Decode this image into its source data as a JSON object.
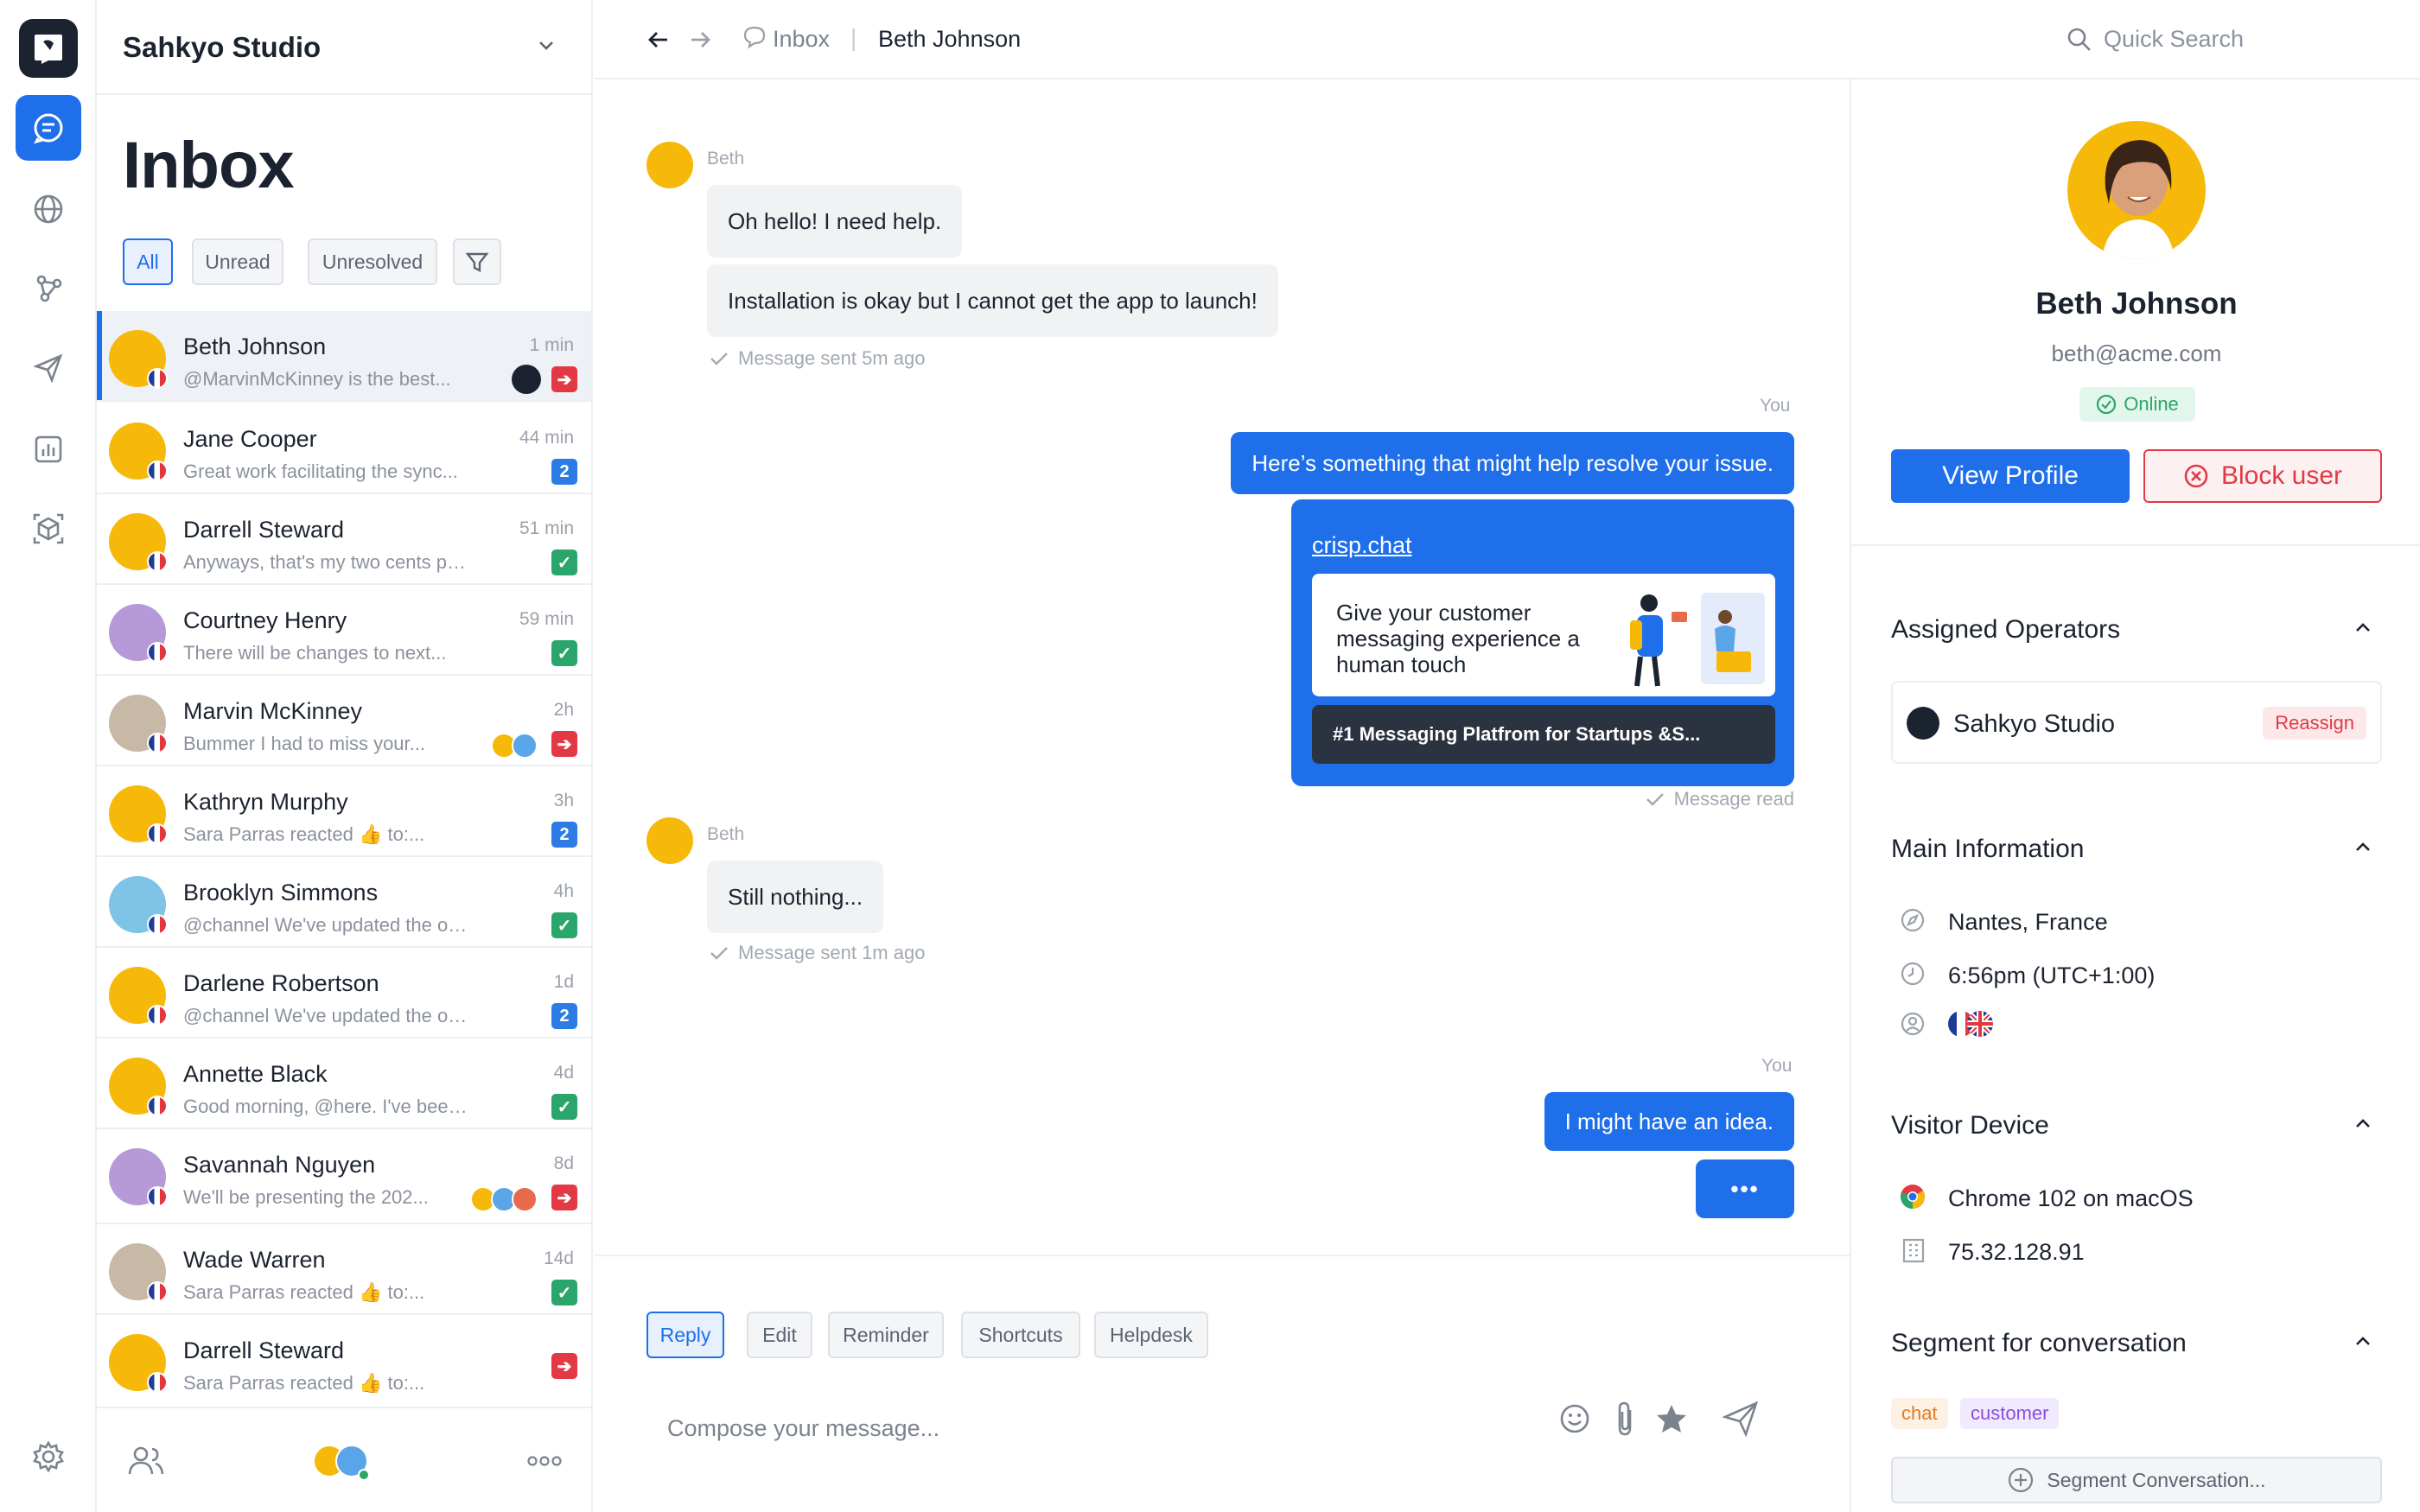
{
  "workspace": {
    "name": "Sahkyo Studio"
  },
  "inbox": {
    "title": "Inbox",
    "filters": [
      "All",
      "Unread",
      "Unresolved"
    ],
    "conversations": [
      {
        "name": "Beth Johnson",
        "preview": "@MarvinMcKinney is the best...",
        "time": "1 min",
        "badge": "",
        "badge_color": "red"
      },
      {
        "name": "Jane Cooper",
        "preview": "Great work facilitating the sync...",
        "time": "44 min",
        "badge": "2",
        "badge_color": "blue"
      },
      {
        "name": "Darrell Steward",
        "preview": "Anyways, that's my two cents plan...",
        "time": "51 min",
        "badge": "✓",
        "badge_color": "green"
      },
      {
        "name": "Courtney Henry",
        "preview": "There will be changes to next...",
        "time": "59 min",
        "badge": "✓",
        "badge_color": "green"
      },
      {
        "name": "Marvin McKinney",
        "preview": "Bummer I had to miss your...",
        "time": "2h",
        "badge": "",
        "badge_color": "red"
      },
      {
        "name": "Kathryn Murphy",
        "preview": "Sara Parras reacted 👍 to:...",
        "time": "3h",
        "badge": "2",
        "badge_color": "blue"
      },
      {
        "name": "Brooklyn Simmons",
        "preview": "@channel We've updated the open...",
        "time": "4h",
        "badge": "✓",
        "badge_color": "green"
      },
      {
        "name": "Darlene Robertson",
        "preview": "@channel We've updated the open...",
        "time": "1d",
        "badge": "2",
        "badge_color": "blue"
      },
      {
        "name": "Annette Black",
        "preview": "Good morning, @here. I've been havin...",
        "time": "4d",
        "badge": "✓",
        "badge_color": "green"
      },
      {
        "name": "Savannah Nguyen",
        "preview": "We'll be presenting the 202...",
        "time": "8d",
        "badge": "",
        "badge_color": "red"
      },
      {
        "name": "Wade Warren",
        "preview": "Sara Parras reacted 👍 to:...",
        "time": "14d",
        "badge": "✓",
        "badge_color": "green"
      },
      {
        "name": "Darrell Steward",
        "preview": "Sara Parras reacted 👍 to:...",
        "time": "",
        "badge": "",
        "badge_color": "red"
      }
    ]
  },
  "topbar": {
    "breadcrumb_inbox": "Inbox",
    "breadcrumb_contact": "Beth Johnson",
    "search_label": "Quick Search"
  },
  "chat": {
    "sender_beth": "Beth",
    "sender_you": "You",
    "msg1": "Oh hello! I need help.",
    "msg2": "Installation is okay but I cannot get the app to launch!",
    "status1": "Message sent 5m ago",
    "msg3": "Here’s something that might help resolve your issue.",
    "card_link": "crisp.chat",
    "card_text": "Give your customer messaging experience a human touch",
    "card_title": "#1 Messaging Platfrom for Startups &S...",
    "status_read": "Message read",
    "msg4": "Still nothing...",
    "status2": "Message sent 1m ago",
    "msg5": "I might have an idea.",
    "typing": "•••"
  },
  "composer": {
    "tabs": [
      "Reply",
      "Edit",
      "Reminder",
      "Shortcuts",
      "Helpdesk"
    ],
    "placeholder": "Compose your message..."
  },
  "profile": {
    "name": "Beth Johnson",
    "email": "beth@acme.com",
    "status": "Online",
    "view_profile": "View Profile",
    "block_user": "Block user",
    "assigned_title": "Assigned Operators",
    "operator": "Sahkyo Studio",
    "reassign": "Reassign",
    "main_title": "Main Information",
    "location": "Nantes, France",
    "local_time": "6:56pm (UTC+1:00)",
    "device_title": "Visitor Device",
    "browser": "Chrome 102 on macOS",
    "ip": "75.32.128.91",
    "segment_title": "Segment for conversation",
    "segments": [
      "chat",
      "customer"
    ],
    "segment_button": "Segment Conversation..."
  },
  "colors": {
    "accent": "#1f6fea",
    "danger": "#e23945",
    "success": "#2ba66a",
    "avatar_yellow": "#f6b90a"
  }
}
